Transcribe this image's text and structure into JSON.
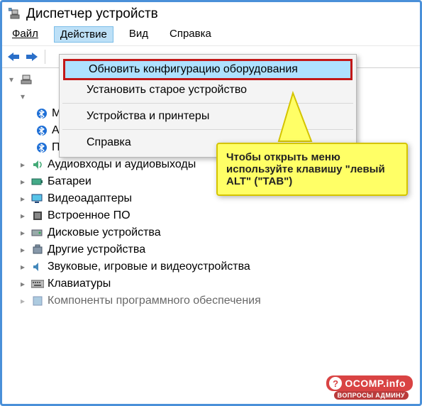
{
  "window": {
    "title": "Диспетчер устройств"
  },
  "menubar": {
    "file": "Файл",
    "action": "Действие",
    "view": "Вид",
    "help": "Справка"
  },
  "dropdown": {
    "refresh": "Обновить конфигурацию оборудования",
    "legacy": "Установить старое устройство",
    "devprinters": "Устройства и принтеры",
    "help": "Справка"
  },
  "tree": {
    "root_icon": "computer-icon",
    "bluetooth": {
      "item1": "Microsoft Bluetooth E",
      "item2": "Адаптер транспорта A",
      "item3": "Перечислитель Bluetooth LE (Майкрософт)"
    },
    "categories": [
      {
        "icon": "audio-icon",
        "label": "Аудиовходы и аудиовыходы"
      },
      {
        "icon": "battery-icon",
        "label": "Батареи"
      },
      {
        "icon": "display-icon",
        "label": "Видеоадаптеры"
      },
      {
        "icon": "firmware-icon",
        "label": "Встроенное ПО"
      },
      {
        "icon": "disk-icon",
        "label": "Дисковые устройства"
      },
      {
        "icon": "other-icon",
        "label": "Другие устройства"
      },
      {
        "icon": "sound-icon",
        "label": "Звуковые, игровые и видеоустройства"
      },
      {
        "icon": "keyboard-icon",
        "label": "Клавиатуры"
      },
      {
        "icon": "software-icon",
        "label": "Компоненты программного обеспечения"
      }
    ]
  },
  "callout": {
    "text": "Чтобы открыть меню используйте клавишу \"левый ALT\" (\"TAB\")"
  },
  "watermark": {
    "main": "OCOMP.info",
    "sub": "ВОПРОСЫ АДМИНУ"
  }
}
